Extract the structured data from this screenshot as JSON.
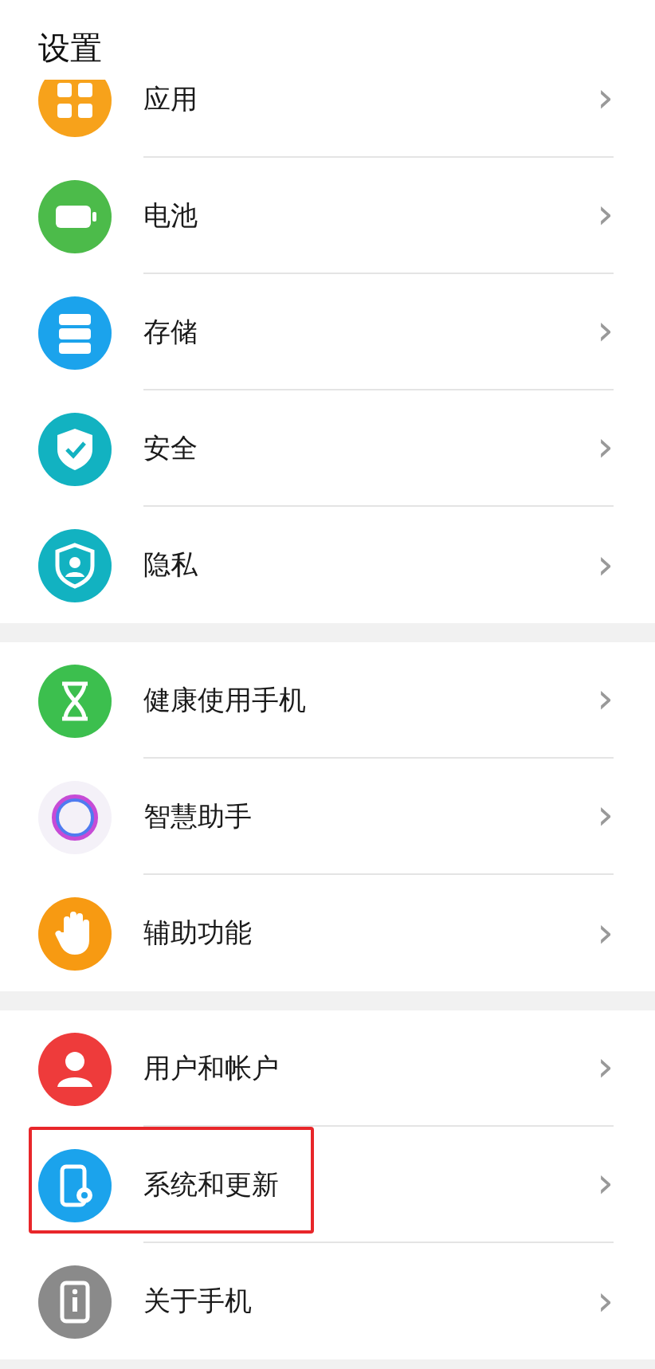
{
  "header": {
    "title": "设置"
  },
  "groups": [
    {
      "items": [
        {
          "label": "应用",
          "kind": "apps",
          "color": "#f7a21b",
          "chevron": "›",
          "highlighted": false
        },
        {
          "label": "电池",
          "kind": "battery",
          "color": "#4cbb4a",
          "chevron": "›",
          "highlighted": false
        },
        {
          "label": "存储",
          "kind": "storage",
          "color": "#1ba3ec",
          "chevron": "›",
          "highlighted": false
        },
        {
          "label": "安全",
          "kind": "shield",
          "color": "#12b2c1",
          "chevron": "›",
          "highlighted": false
        },
        {
          "label": "隐私",
          "kind": "privacy",
          "color": "#12b2c1",
          "chevron": "›",
          "highlighted": false
        }
      ]
    },
    {
      "items": [
        {
          "label": "健康使用手机",
          "kind": "hourglass",
          "color": "#3cbf4e",
          "chevron": "›",
          "highlighted": false
        },
        {
          "label": "智慧助手",
          "kind": "ring",
          "color": "#f4f1f8",
          "chevron": "›",
          "highlighted": false
        },
        {
          "label": "辅助功能",
          "kind": "hand",
          "color": "#f79a12",
          "chevron": "›",
          "highlighted": false
        }
      ]
    },
    {
      "items": [
        {
          "label": "用户和帐户",
          "kind": "user",
          "color": "#ee3b3b",
          "chevron": "›",
          "highlighted": false
        },
        {
          "label": "系统和更新",
          "kind": "system",
          "color": "#1ba3ec",
          "chevron": "›",
          "highlighted": true
        },
        {
          "label": "关于手机",
          "kind": "info",
          "color": "#8a8a8a",
          "chevron": "›",
          "highlighted": false
        }
      ]
    }
  ]
}
